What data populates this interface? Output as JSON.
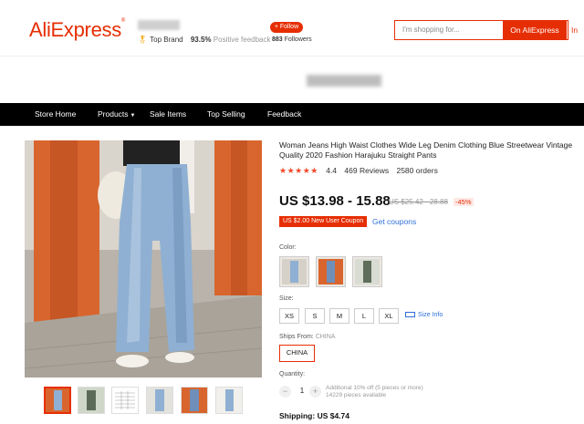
{
  "header": {
    "logo": "AliExpress",
    "badge": "Top Brand",
    "positive_pct": "93.5%",
    "positive_label": "Positive feedback",
    "follow_label": "+ Follow",
    "followers_count": "883",
    "followers_label": "Followers",
    "search_placeholder": "I'm shopping for...",
    "search_button": "On AliExpress",
    "search_button2": "In this store"
  },
  "nav": {
    "items": [
      "Store Home",
      "Products",
      "Sale Items",
      "Top Selling",
      "Feedback"
    ]
  },
  "product": {
    "title": "Woman Jeans High Waist Clothes Wide Leg Denim Clothing Blue Streetwear Vintage Quality 2020 Fashion Harajuku Straight Pants",
    "stars": "★★★★★",
    "rating": "4.4",
    "reviews": "469 Reviews",
    "orders": "2580 orders",
    "price": "US $13.98 - 15.88",
    "original_price": "US $25.42 - 28.88",
    "discount": "-45%",
    "coupon": "US $2.00 New User Coupon",
    "get_coupons": "Get coupons",
    "color_label": "Color:",
    "size_label": "Size:",
    "sizes": [
      "XS",
      "S",
      "M",
      "L",
      "XL"
    ],
    "size_info": "Size Info",
    "ships_from_label": "Ships From:",
    "ships_from_value": "CHINA",
    "ship_option": "CHINA",
    "quantity_label": "Quantity:",
    "quantity": "1",
    "minus": "−",
    "plus": "+",
    "qty_note_1": "Additional 10% off (5 pieces or more)",
    "qty_note_2": "14229 pieces available",
    "shipping_label": "Shipping:",
    "shipping_value": "US $4.74"
  },
  "colors": {
    "brand_red": "#e62e04",
    "link_blue": "#2e6fd8",
    "nav_bg": "#000000"
  }
}
